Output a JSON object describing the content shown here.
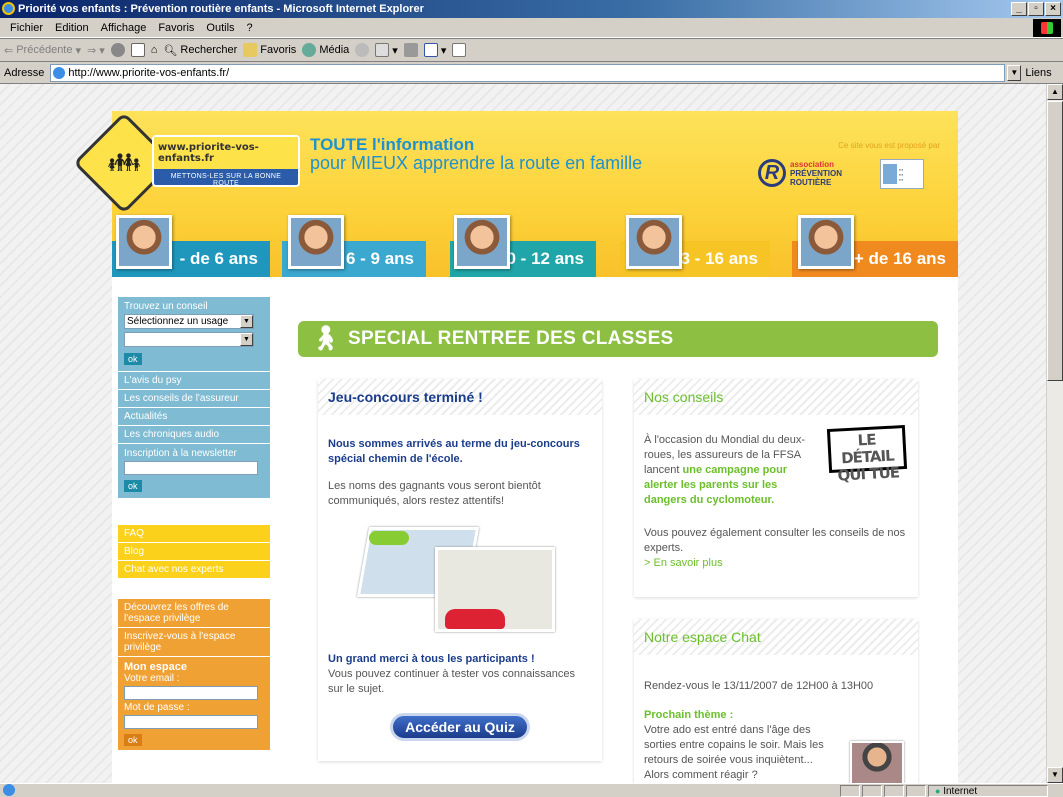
{
  "window": {
    "title": "Priorité vos enfants : Prévention routière enfants - Microsoft Internet Explorer",
    "controls": [
      "_",
      "▫",
      "×"
    ]
  },
  "menu": [
    "Fichier",
    "Edition",
    "Affichage",
    "Favoris",
    "Outils",
    "?"
  ],
  "toolbar": {
    "back": "Précédente",
    "search": "Rechercher",
    "favorites": "Favoris",
    "media": "Média"
  },
  "address": {
    "label": "Adresse",
    "url": "http://www.priorite-vos-enfants.fr/",
    "links": "Liens"
  },
  "status": {
    "zone": "Internet"
  },
  "banner": {
    "logo_url": "www.priorite-vos-enfants.fr",
    "logo_tag": "METTONS-LES SUR LA BONNE ROUTE",
    "tagline1": "TOUTE l'information",
    "tagline2": "pour MIEUX apprendre la route en famille",
    "sponsor": "Ce site vous est proposé par",
    "apr_line1": "association",
    "apr_line2": "PRÉVENTION",
    "apr_line3": "ROUTIÈRE",
    "ages": [
      {
        "label": "- de 6 ans",
        "color": "#1f97bd"
      },
      {
        "label": "6 - 9 ans",
        "color": "#3aa8cf"
      },
      {
        "label": "10 - 12 ans",
        "color": "#20a6a8"
      },
      {
        "label": "13 - 16 ans",
        "color": "#f6c424"
      },
      {
        "label": "+ de 16 ans",
        "color": "#f08a1e"
      }
    ]
  },
  "sidebar": {
    "find_label": "Trouvez un conseil",
    "select1": "Sélectionnez un usage",
    "ok": "ok",
    "blue_items": [
      "L'avis du psy",
      "Les conseils de l'assureur",
      "Actualités",
      "Les chroniques audio"
    ],
    "newsletter": "Inscription à la newsletter",
    "yellow_items": [
      "FAQ",
      "Blog",
      "Chat avec nos experts"
    ],
    "orange_items": [
      "Découvrez les offres de l'espace privilège",
      "Inscrivez-vous à l'espace privilège"
    ],
    "myspace_title": "Mon espace",
    "email_label": "Votre email :",
    "password_label": "Mot de passe :"
  },
  "special": "SPECIAL RENTREE DES CLASSES",
  "contest": {
    "title": "Jeu-concours terminé !",
    "lead": "Nous sommes arrivés au terme du jeu-concours spécial chemin de l'école.",
    "text": "Les noms des gagnants vous seront bientôt communiqués, alors restez attentifs!",
    "thanks": "Un grand merci à tous les participants !",
    "thanks_text": "Vous pouvez continuer à tester vos connaissances sur le sujet.",
    "button": "Accéder au Quiz"
  },
  "advice": {
    "title": "Nos conseils",
    "text1": "À l'occasion du Mondial du deux-roues, les assureurs de la FFSA lancent",
    "highlight": "une campagne pour alerter les parents sur les dangers du cyclomoteur.",
    "badge": "LE DÉTAIL QUI TUE",
    "text2": "Vous pouvez également consulter les conseils de nos experts.",
    "more": "> En savoir plus"
  },
  "chat": {
    "title": "Notre espace Chat",
    "date": "Rendez-vous le 13/11/2007 de 12H00 à 13H00",
    "next": "Prochain thème :",
    "text": "Votre ado est entré dans l'âge des sorties entre copains le soir. Mais les retours de soirée vous inquiètent...",
    "cut": "Alors comment réagir ?"
  }
}
